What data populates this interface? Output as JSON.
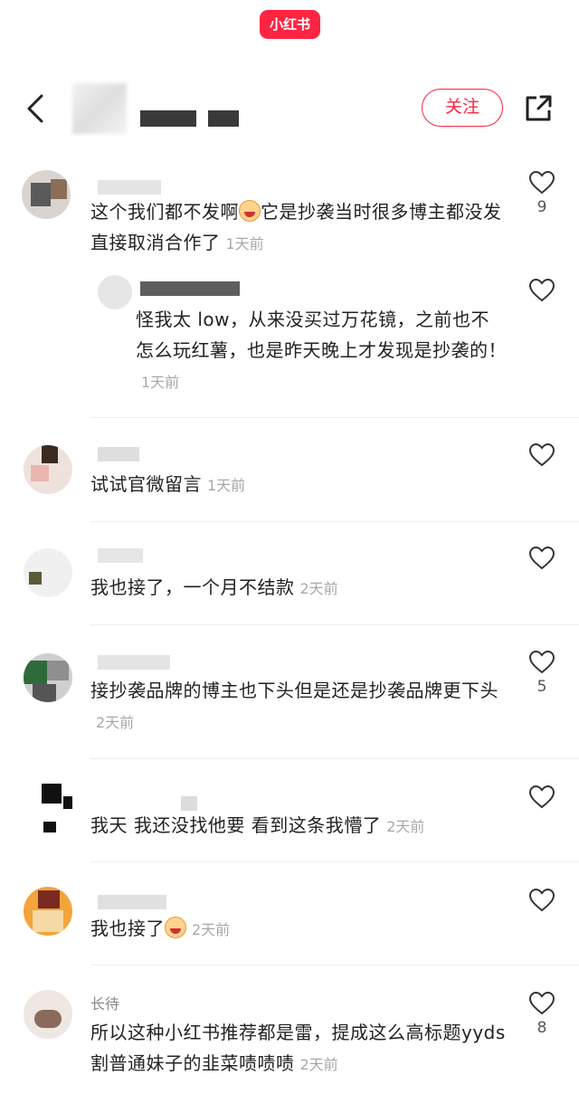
{
  "app": {
    "logo_text": "小红书"
  },
  "header": {
    "follow_label": "关注"
  },
  "comments": [
    {
      "text": "这个我们都不发啊",
      "text_after_emoji": "它是抄袭当时很多博主都没发直接取消合作了",
      "time": "1天前",
      "likes": "9",
      "reply": {
        "text": "怪我太 low，从来没买过万花镜，之前也不怎么玩红薯，也是昨天晚上才发现是抄袭的！",
        "time": "1天前"
      }
    },
    {
      "text": "试试官微留言",
      "time": "1天前",
      "likes": ""
    },
    {
      "text": "我也接了，一个月不结款",
      "time": "2天前",
      "likes": ""
    },
    {
      "text": "接抄袭品牌的博主也下头但是还是抄袭品牌更下头",
      "time": "2天前",
      "likes": "5"
    },
    {
      "text": "我天 我还没找他要 看到这条我懵了",
      "time": "2天前",
      "likes": ""
    },
    {
      "text": "我也接了",
      "time": "2天前",
      "likes": ""
    },
    {
      "username_partial": "长待",
      "text": "所以这种小红书推荐都是雷，提成这么高标题yyds割普通妹子的韭菜啧啧啧",
      "time": "2天前",
      "likes": "8"
    }
  ],
  "icons": {
    "back": "chevron-left-icon",
    "share": "share-icon",
    "like": "heart-outline-icon"
  },
  "colors": {
    "brand": "#ff2442",
    "time_text": "#a8a8a8"
  }
}
